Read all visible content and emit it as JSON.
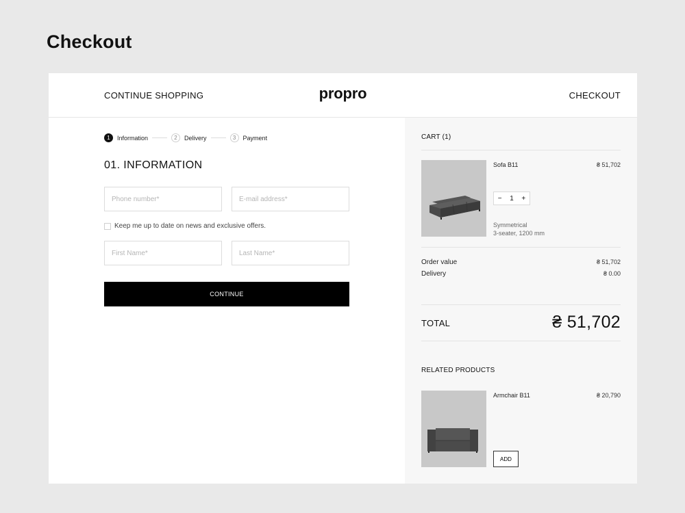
{
  "page": {
    "title": "Checkout"
  },
  "header": {
    "continue_shopping": "CONTINUE SHOPPING",
    "logo": "propro",
    "checkout": "CHECKOUT"
  },
  "steps": [
    {
      "number": "1",
      "label": "Information",
      "active": true
    },
    {
      "number": "2",
      "label": "Delivery",
      "active": false
    },
    {
      "number": "3",
      "label": "Payment",
      "active": false
    }
  ],
  "form": {
    "section_title": "01. INFORMATION",
    "phone_placeholder": "Phone number*",
    "email_placeholder": "E-mail address*",
    "newsletter_label": "Keep me up to date on news and exclusive offers.",
    "first_name_placeholder": "First Name*",
    "last_name_placeholder": "Last Name*",
    "continue_label": "CONTINUE"
  },
  "cart": {
    "title": "CART (1)",
    "items": [
      {
        "name": "Sofa B11",
        "price": "₴ 51,702",
        "quantity": "1",
        "minus": "−",
        "plus": "+",
        "desc_line1": "Symmetrical",
        "desc_line2": "3-seater, 1200 mm"
      }
    ],
    "order_value_label": "Order value",
    "order_value": "₴ 51,702",
    "delivery_label": "Delivery",
    "delivery_value": "₴ 0.00",
    "total_label": "TOTAL",
    "total_value": "₴ 51,702"
  },
  "related": {
    "title": "RELATED PRODUCTS",
    "items": [
      {
        "name": "Armchair B11",
        "price": "₴ 20,790",
        "add_label": "ADD"
      }
    ]
  }
}
